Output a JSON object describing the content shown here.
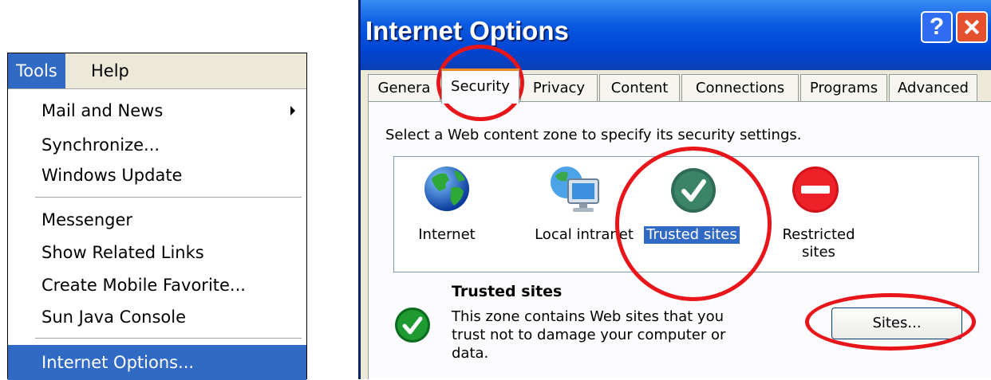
{
  "tools_menu": {
    "menubar": [
      "Tools",
      "Help"
    ],
    "items": [
      "Mail and News",
      "Synchronize...",
      "Windows Update",
      "Messenger",
      "Show Related Links",
      "Create Mobile Favorite...",
      "Sun Java Console",
      "Internet Options..."
    ],
    "highlighted": "Internet Options..."
  },
  "dialog": {
    "title": "Internet Options",
    "tabs": [
      "Genera",
      "Security",
      "Privacy",
      "Content",
      "Connections",
      "Programs",
      "Advanced"
    ],
    "active_tab": "Security",
    "instruction": "Select a Web content zone to specify its security settings.",
    "zones": [
      {
        "label": "Internet",
        "icon": "globe-icon"
      },
      {
        "label": "Local intranet",
        "icon": "intranet-icon"
      },
      {
        "label": "Trusted sites",
        "icon": "trusted-check-icon"
      },
      {
        "label": "Restricted\nsites",
        "icon": "restricted-icon"
      }
    ],
    "selected_zone": "Trusted sites",
    "zone_title": "Trusted sites",
    "zone_description": "This zone contains Web sites that you trust not to damage your computer or data.",
    "sites_button": "Sites..."
  },
  "colors": {
    "highlight": "#316ac5",
    "annotation": "#e8161b",
    "titlebar": "#0a5ae0"
  }
}
